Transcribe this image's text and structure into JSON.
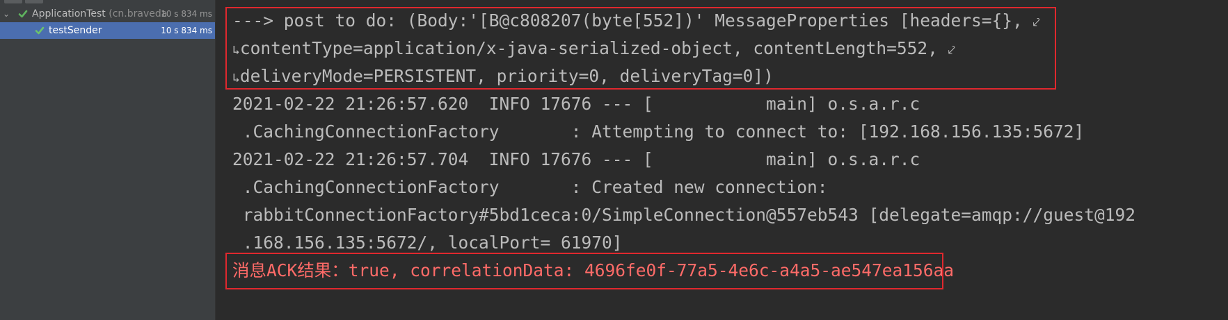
{
  "tree": {
    "root": {
      "name": "ApplicationTest",
      "pkg": "(cn.braveda",
      "time": "10 s 834 ms"
    },
    "child": {
      "name": "testSender",
      "time": "10 s 834 ms"
    }
  },
  "console": {
    "lines": [
      "---> post to do: (Body:'[B@c808207(byte[552])' MessageProperties [headers={},",
      "contentType=application/x-java-serialized-object, contentLength=552,",
      "deliveryMode=PERSISTENT, priority=0, deliveryTag=0])",
      "2021-02-22 21:26:57.620  INFO 17676 --- [           main] o.s.a.r.c",
      " .CachingConnectionFactory       : Attempting to connect to: [192.168.156.135:5672]",
      "2021-02-22 21:26:57.704  INFO 17676 --- [           main] o.s.a.r.c",
      " .CachingConnectionFactory       : Created new connection:",
      " rabbitConnectionFactory#5bd1ceca:0/SimpleConnection@557eb543 [delegate=amqp://guest@192",
      " .168.156.135:5672/, localPort= 61970]",
      "消息ACK结果：true, correlationData: 4696fe0f-77a5-4e6c-a4a5-ae547ea156aa"
    ],
    "wrap_glyph": "⤦",
    "wrap_start_glyph": "↳"
  },
  "colors": {
    "background": "#2b2b2b",
    "text": "#bbbbbb",
    "error": "#ff6b68",
    "highlight_box": "#e0282e",
    "selection": "#4b6eaf"
  }
}
